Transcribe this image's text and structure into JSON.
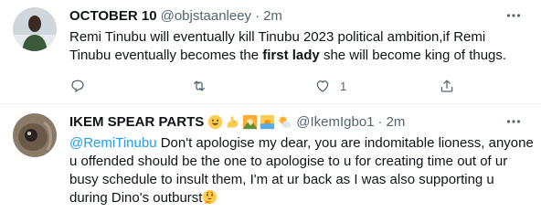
{
  "tweets": [
    {
      "name": "OCTOBER 10",
      "handle": "@objstaanleey",
      "separator": "·",
      "time": "2m",
      "lines": [
        {
          "text": "Remi Tinubu will eventually kill Tinubu 2023 political ambition,if Remi"
        },
        {
          "pre": "Tinubu eventually becomes the ",
          "bold": "first lady",
          "post": " she will become king of thugs."
        }
      ],
      "actions": {
        "like_count": "1"
      }
    },
    {
      "name": "IKEM SPEAR PARTS",
      "name_emojis": [
        "smiley-emoji",
        "flexed-biceps-emoji",
        "sunrise-over-mountains-emoji",
        "sunrise-emoji",
        "sun-behind-cloud-emoji"
      ],
      "handle": "@IkemIgbo1",
      "separator": "·",
      "time": "2m",
      "mention": "@RemiTinubu",
      "lines": [
        " Don't apologise my dear, you are indomitable lioness, anyone",
        "u offended should be the one to apologise to u for creating time out of ur",
        "busy schedule to insult them, I'm at ur back as I was also supporting u",
        "during Dino's outburst"
      ],
      "trailing_emoji": "thinking-face-emoji"
    }
  ]
}
